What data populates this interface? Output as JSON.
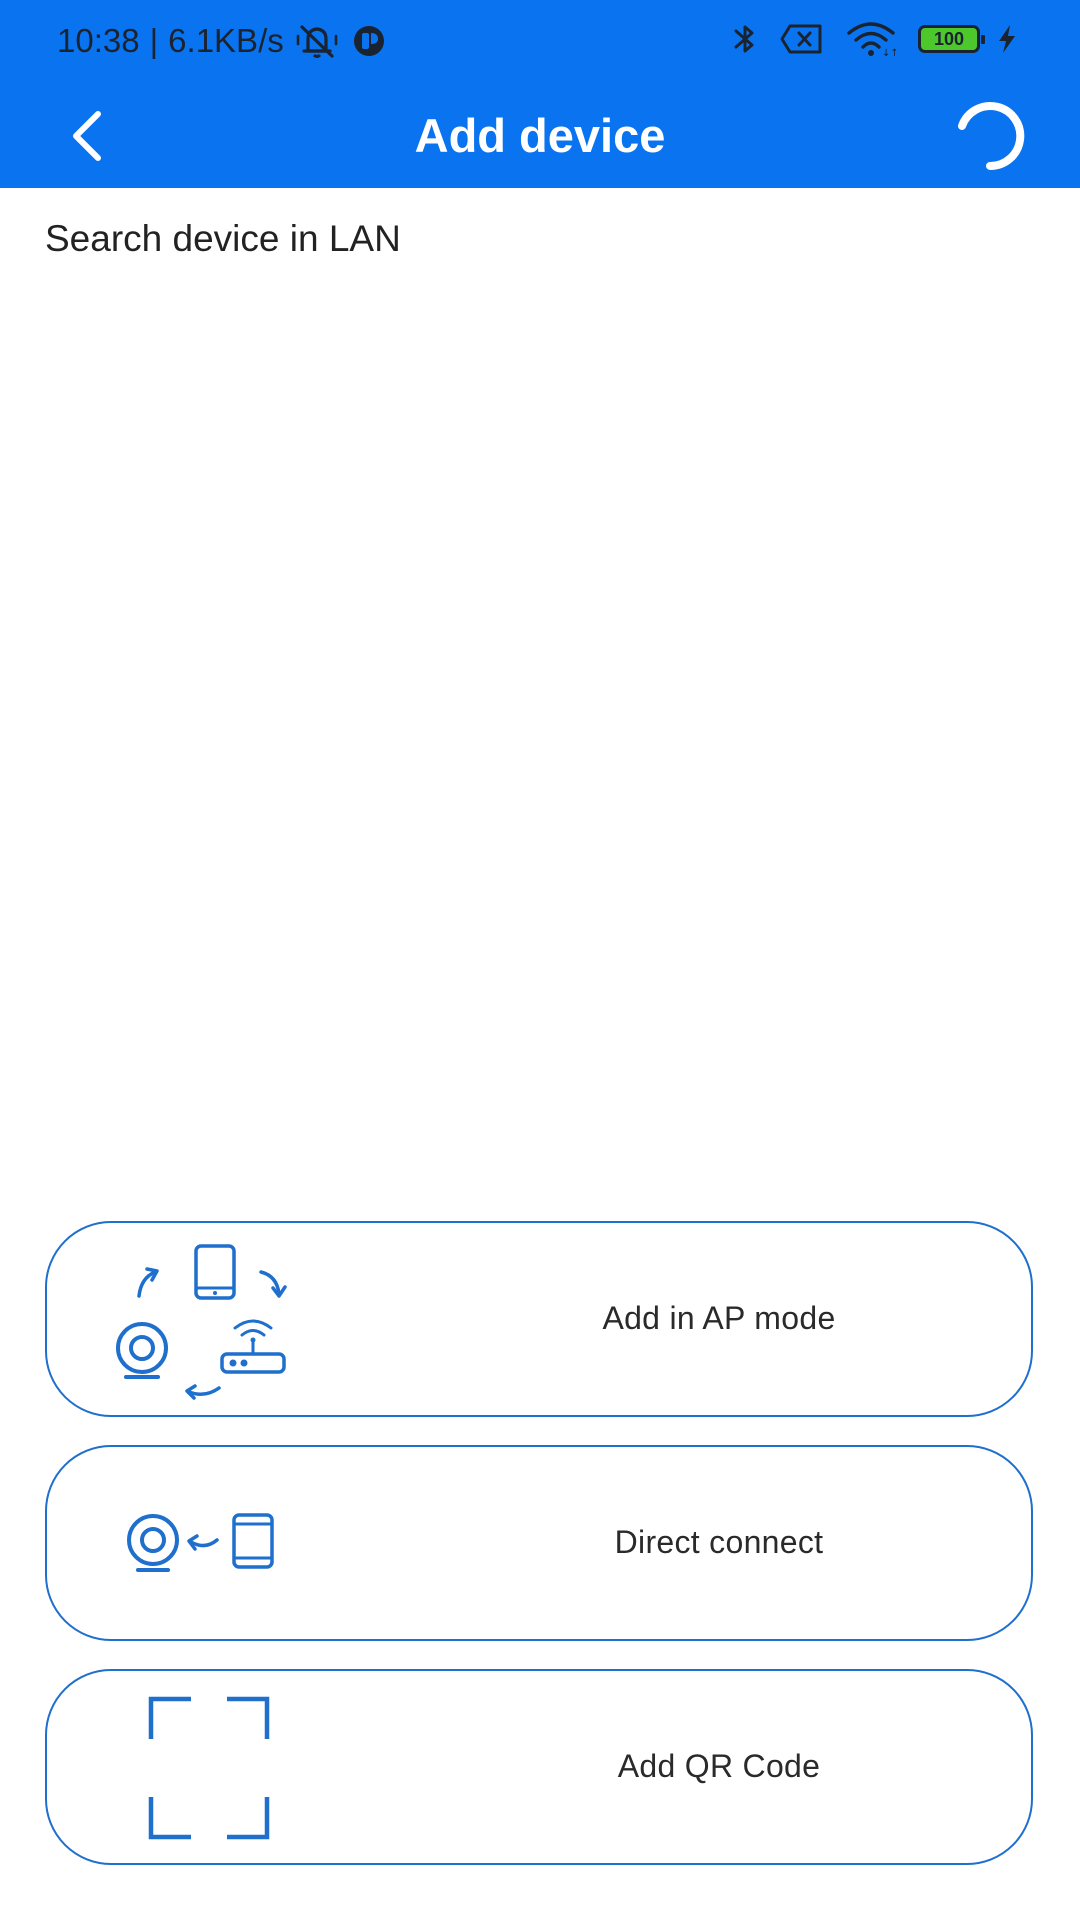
{
  "status_bar": {
    "time": "10:38",
    "separator": "|",
    "net_speed": "6.1KB/s",
    "battery_level": "100"
  },
  "header": {
    "title": "Add device",
    "back_icon": "chevron-left-icon",
    "refresh_icon": "refresh-spinner-icon"
  },
  "main": {
    "search_label": "Search device in LAN"
  },
  "options": [
    {
      "label": "Add in AP mode",
      "icon": "ap-mode-icon"
    },
    {
      "label": "Direct connect",
      "icon": "direct-connect-icon"
    },
    {
      "label": "Add QR Code",
      "icon": "qr-scan-icon"
    }
  ],
  "colors": {
    "primary": "#0a74f0",
    "outline": "#1f6fcc",
    "battery": "#4cc72c",
    "text": "#222222"
  }
}
